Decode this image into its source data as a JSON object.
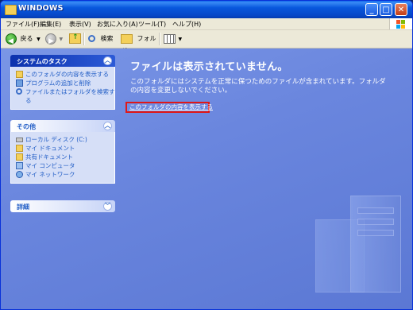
{
  "window": {
    "title": "WINDOWS",
    "controls": {
      "minimize": "_",
      "maximize": "□",
      "close": "✕"
    }
  },
  "menu": {
    "items": [
      "ファイル(F)",
      "編集(E)",
      "表示(V)",
      "お気に入り(A)",
      "ツール(T)",
      "ヘルプ(H)"
    ]
  },
  "toolbar": {
    "back_label": "戻る",
    "search_label": "検索",
    "folders_label": "フォルダ"
  },
  "sidebar": {
    "system_tasks": {
      "title": "システムのタスク",
      "items": [
        "このフォルダの内容を表示する",
        "プログラムの追加と削除",
        "ファイルまたはフォルダを検索す",
        "る"
      ]
    },
    "other_places": {
      "title": "その他",
      "items": [
        "ローカル ディスク (C:)",
        "マイ ドキュメント",
        "共有ドキュメント",
        "マイ コンピュータ",
        "マイ ネットワーク"
      ]
    },
    "details": {
      "title": "詳細"
    }
  },
  "main": {
    "heading": "ファイルは表示されていません。",
    "message_line1": "このフォルダにはシステムを正常に保つためのファイルが含まれています。フォルダ",
    "message_line2": "の内容を変更しないでください。",
    "show_contents_link": "このフォルダの内容を表示する"
  },
  "colors": {
    "titlebar": "#0857dd",
    "content_bg": "#6a86de",
    "highlight_border": "#e01818",
    "link": "#215dc6"
  }
}
